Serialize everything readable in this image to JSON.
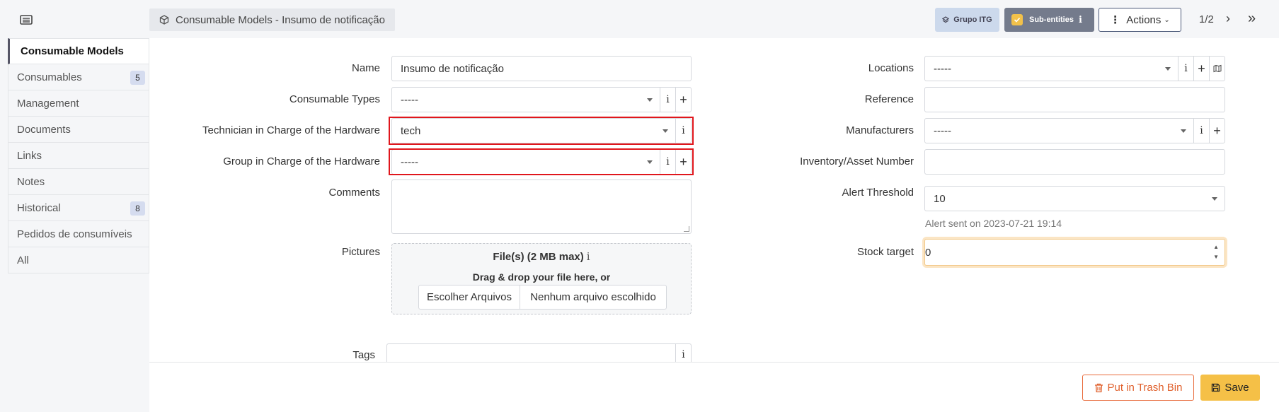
{
  "breadcrumb": {
    "title": "Consumable Models - Insumo de notificação"
  },
  "header": {
    "entity_button": "Grupo ITG",
    "subentities_label": "Sub-entities",
    "subentities_info": "i",
    "actions_label": "Actions",
    "pager": "1/2"
  },
  "sidebar": {
    "tabs": [
      {
        "label": "Consumable Models",
        "active": true
      },
      {
        "label": "Consumables",
        "count": "5"
      },
      {
        "label": "Management"
      },
      {
        "label": "Documents"
      },
      {
        "label": "Links"
      },
      {
        "label": "Notes"
      },
      {
        "label": "Historical",
        "count": "8"
      },
      {
        "label": "Pedidos de consumíveis"
      },
      {
        "label": "All"
      }
    ]
  },
  "form": {
    "name": {
      "label": "Name",
      "value": "Insumo de notificação"
    },
    "consumable_types": {
      "label": "Consumable Types",
      "value": "-----"
    },
    "technician": {
      "label": "Technician in Charge of the Hardware",
      "value": "tech"
    },
    "group": {
      "label": "Group in Charge of the Hardware",
      "value": "-----"
    },
    "comments": {
      "label": "Comments",
      "value": ""
    },
    "pictures": {
      "label": "Pictures",
      "title": "File(s) (2 MB max)",
      "drag_text": "Drag & drop your file here, or",
      "choose_button": "Escolher Arquivos",
      "no_file": "Nenhum arquivo escolhido"
    },
    "tags": {
      "label": "Tags",
      "value": ""
    },
    "locations": {
      "label": "Locations",
      "value": "-----"
    },
    "reference": {
      "label": "Reference",
      "value": ""
    },
    "manufacturers": {
      "label": "Manufacturers",
      "value": "-----"
    },
    "inventory": {
      "label": "Inventory/Asset Number",
      "value": ""
    },
    "alert_threshold": {
      "label": "Alert Threshold",
      "value": "10",
      "note": "Alert sent on 2023-07-21 19:14"
    },
    "stock_target": {
      "label": "Stock target",
      "value": "0"
    }
  },
  "footer": {
    "trash_label": "Put in Trash Bin",
    "save_label": "Save"
  },
  "colors": {
    "highlight": "#e0161c",
    "save": "#f5c047",
    "trash": "#e0602c",
    "subentities": "#747b8c"
  },
  "icons": {
    "info": "i",
    "plus": "+",
    "next": "›",
    "last": "»"
  }
}
